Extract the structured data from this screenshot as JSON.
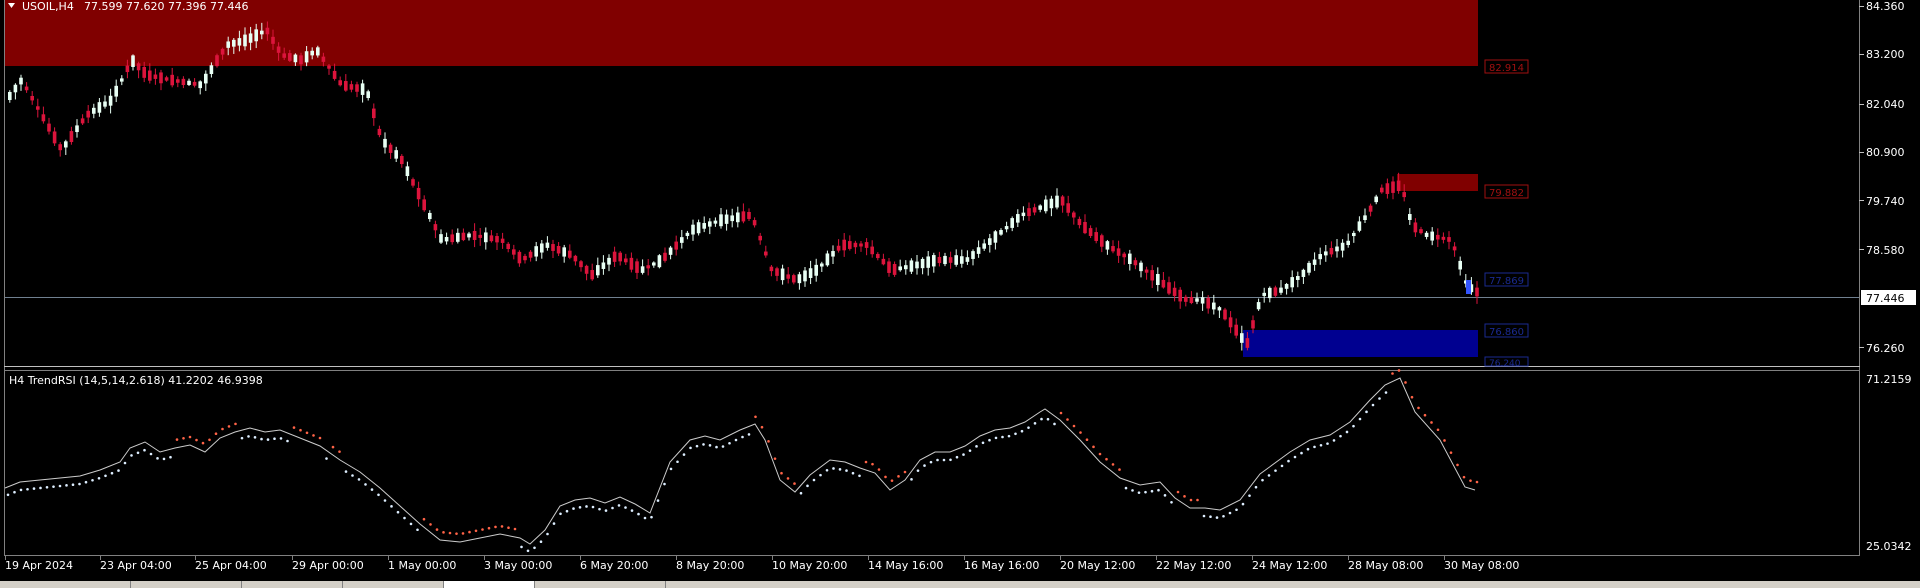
{
  "main_chart": {
    "header_symbol": "USOIL,H4",
    "header_ohlc": "77.599 77.620 77.396 77.446",
    "price_ticks": [
      "84.360",
      "83.200",
      "82.040",
      "80.900",
      "79.740",
      "78.580",
      "76.260"
    ],
    "current_price": "77.446",
    "zone_labels": {
      "supply_top": "82.914",
      "supply_small": "79.882",
      "demand_upper": "77.869",
      "demand_middle": "76.860",
      "demand_lower": "76.240"
    }
  },
  "indicator": {
    "header": "H4  TrendRSI (14,5,14,2.618) 41.2202 46.9398",
    "tick_top": "71.2159",
    "tick_bottom": "25.0342"
  },
  "time_axis": [
    "19 Apr 2024",
    "23 Apr 04:00",
    "25 Apr 04:00",
    "29 Apr 00:00",
    "1 May 00:00",
    "3 May 00:00",
    "6 May 20:00",
    "8 May 20:00",
    "10 May 20:00",
    "14 May 16:00",
    "16 May 16:00",
    "20 May 12:00",
    "22 May 12:00",
    "24 May 12:00",
    "28 May 08:00",
    "30 May 08:00"
  ],
  "colors": {
    "background": "#000000",
    "bull": "#e8fff4",
    "bear": "#dc143c",
    "supply_zone": "#800000",
    "demand_zone": "#000090",
    "price_line": "#708090",
    "rsi_line": "#cccccc",
    "dots_up": "#ddeeff",
    "dots_down": "#ff6347"
  }
}
